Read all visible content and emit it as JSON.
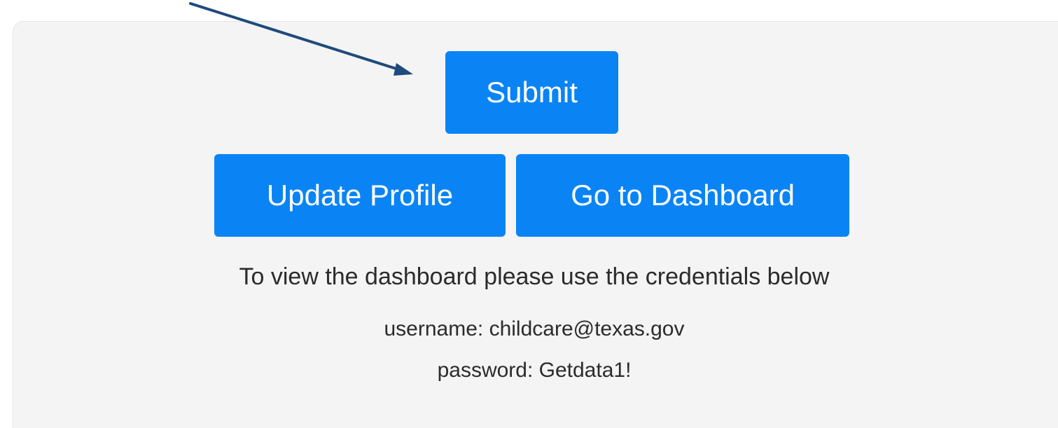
{
  "buttons": {
    "submit_label": "Submit",
    "update_profile_label": "Update Profile",
    "go_to_dashboard_label": "Go to Dashboard"
  },
  "info": {
    "instruction": "To view the dashboard please use the credentials below",
    "username_line": "username: childcare@texas.gov",
    "password_line": "password: Getdata1!"
  },
  "colors": {
    "button_bg": "#0a84f5",
    "button_text": "#ffffff",
    "panel_bg": "#f4f4f4",
    "annotation_arrow": "#1f4a7c"
  }
}
